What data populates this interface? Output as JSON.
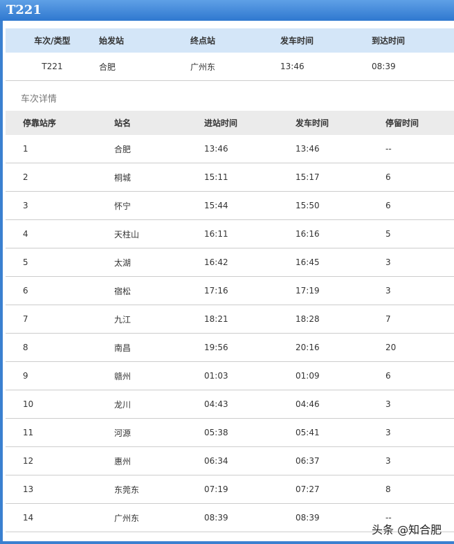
{
  "title": "T221",
  "summary": {
    "headers": [
      "车次/类型",
      "始发站",
      "终点站",
      "发车时间",
      "到达时间"
    ],
    "values": [
      "T221",
      "合肥",
      "广州东",
      "13:46",
      "08:39"
    ]
  },
  "section_label": "车次详情",
  "details": {
    "headers": [
      "停靠站序",
      "站名",
      "进站时间",
      "发车时间",
      "停留时间"
    ],
    "rows": [
      [
        "1",
        "合肥",
        "13:46",
        "13:46",
        "--"
      ],
      [
        "2",
        "桐城",
        "15:11",
        "15:17",
        "6"
      ],
      [
        "3",
        "怀宁",
        "15:44",
        "15:50",
        "6"
      ],
      [
        "4",
        "天柱山",
        "16:11",
        "16:16",
        "5"
      ],
      [
        "5",
        "太湖",
        "16:42",
        "16:45",
        "3"
      ],
      [
        "6",
        "宿松",
        "17:16",
        "17:19",
        "3"
      ],
      [
        "7",
        "九江",
        "18:21",
        "18:28",
        "7"
      ],
      [
        "8",
        "南昌",
        "19:56",
        "20:16",
        "20"
      ],
      [
        "9",
        "赣州",
        "01:03",
        "01:09",
        "6"
      ],
      [
        "10",
        "龙川",
        "04:43",
        "04:46",
        "3"
      ],
      [
        "11",
        "河源",
        "05:38",
        "05:41",
        "3"
      ],
      [
        "12",
        "惠州",
        "06:34",
        "06:37",
        "3"
      ],
      [
        "13",
        "东莞东",
        "07:19",
        "07:27",
        "8"
      ],
      [
        "14",
        "广州东",
        "08:39",
        "08:39",
        "--"
      ]
    ]
  },
  "watermark": "头条 @知合肥"
}
